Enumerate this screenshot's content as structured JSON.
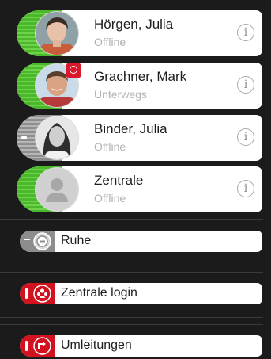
{
  "contacts": [
    {
      "name": "Hörgen, Julia",
      "status": "Offline",
      "indicator": "green",
      "avatar": "photo-woman-short-hair"
    },
    {
      "name": "Grachner, Mark",
      "status": "Unterwegs",
      "indicator": "green",
      "avatar": "photo-man-smiling",
      "badge": "message-badge"
    },
    {
      "name": "Binder, Julia",
      "status": "Offline",
      "indicator": "gray",
      "avatar": "photo-woman-long-hair"
    },
    {
      "name": "Zentrale",
      "status": "Offline",
      "indicator": "green",
      "avatar": "placeholder-person"
    }
  ],
  "info_icon_glyph": "i",
  "functions": [
    {
      "label": "Ruhe",
      "state": "off",
      "icon": "do-not-disturb-icon"
    },
    {
      "label": "Zentrale login",
      "state": "on",
      "icon": "group-icon"
    },
    {
      "label": "Umleitungen",
      "state": "on",
      "icon": "redirect-icon"
    }
  ],
  "colors": {
    "background": "#1b1b1b",
    "available_green": "#4bb82c",
    "active_red": "#d3121f",
    "inactive_gray": "#8d8d8d"
  }
}
